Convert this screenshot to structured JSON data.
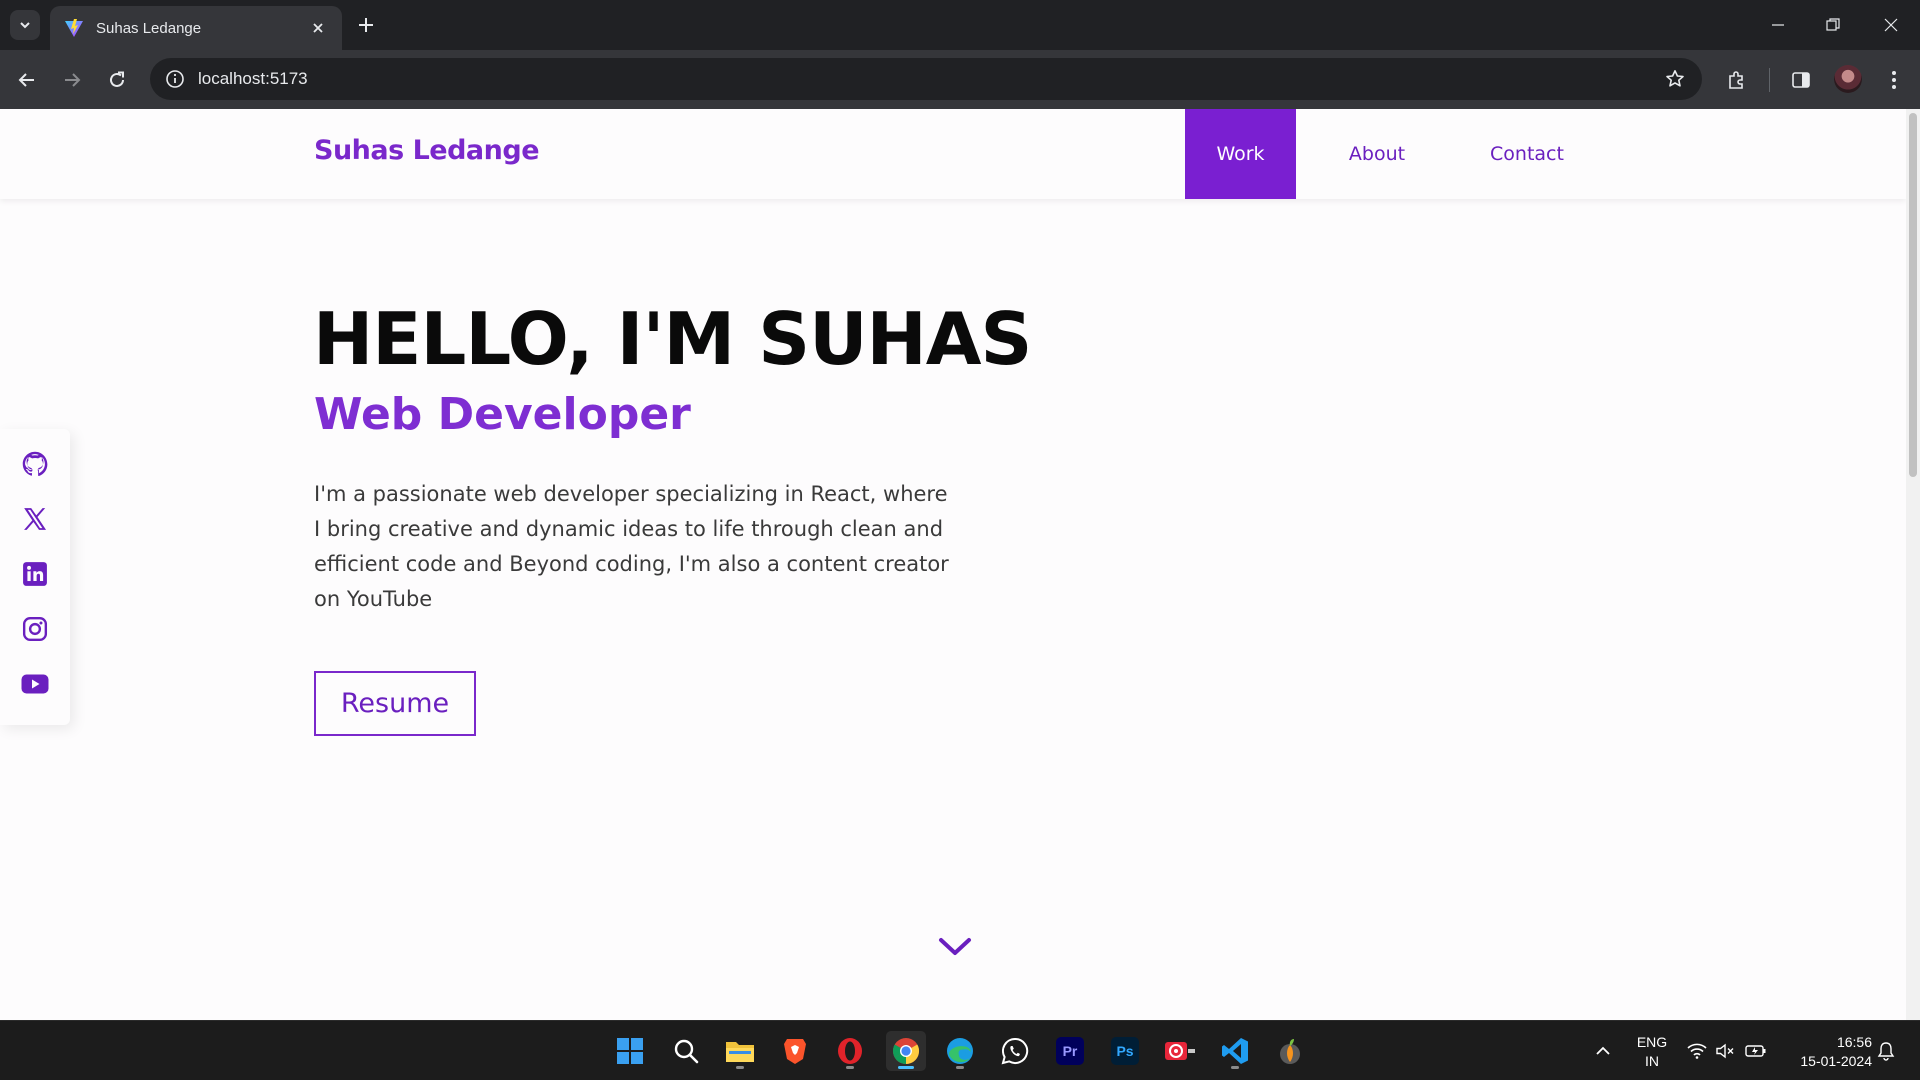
{
  "browser": {
    "tab_title": "Suhas Ledange",
    "url": "localhost:5173"
  },
  "site": {
    "brand": "Suhas Ledange",
    "nav": [
      {
        "label": "Work",
        "active": true
      },
      {
        "label": "About",
        "active": false
      },
      {
        "label": "Contact",
        "active": false
      }
    ],
    "hero": {
      "title": "HELLO, I'M SUHAS",
      "subtitle": "Web Developer",
      "description": "I'm a passionate web developer specializing in React, where I bring creative and dynamic ideas to life through clean and efficient code and Beyond coding, I'm also a content creator on YouTube",
      "resume_label": "Resume"
    },
    "socials": [
      "github-icon",
      "x-twitter-icon",
      "linkedin-icon",
      "instagram-icon",
      "youtube-icon"
    ],
    "colors": {
      "accent": "#7a28cb",
      "nav_active_bg": "#7a1fd1"
    }
  },
  "taskbar": {
    "apps": [
      "start-icon",
      "search-icon",
      "file-explorer-icon",
      "brave-icon",
      "opera-icon",
      "chrome-icon",
      "edge-icon",
      "whatsapp-icon",
      "premiere-pro-icon",
      "photoshop-icon",
      "fl-studio-icon",
      "vscode-icon",
      "fl-studio-fruit-icon"
    ],
    "premiere_label": "Pr",
    "photoshop_label": "Ps",
    "lang_top": "ENG",
    "lang_bottom": "IN",
    "time": "16:56",
    "date": "15-01-2024"
  }
}
